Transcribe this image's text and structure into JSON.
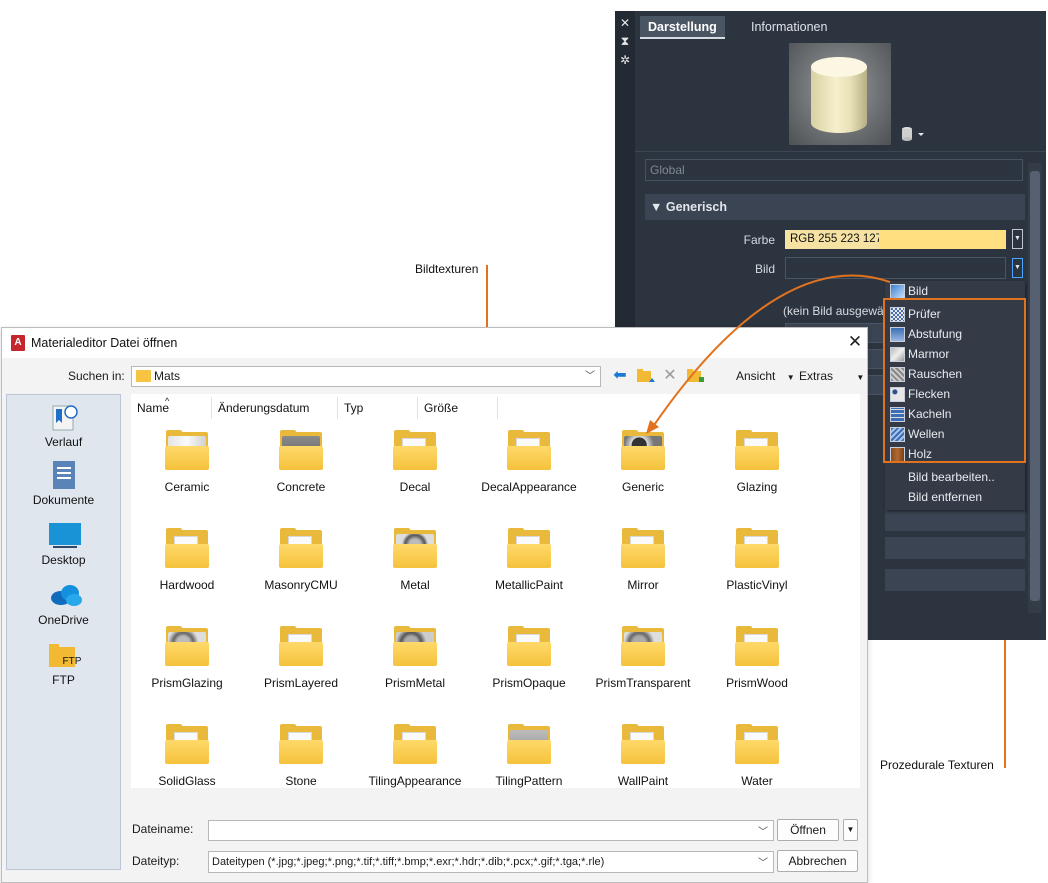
{
  "annotations": {
    "bildtexturen": "Bildtexturen",
    "prozedurale": "Prozedurale Texturen"
  },
  "panel": {
    "tool_close": "✕",
    "tool_pin": "⧗",
    "tool_gear": "✲",
    "tabs": [
      "Darstellung",
      "Informationen"
    ],
    "global": "Global",
    "section": "Generisch",
    "farbe_label": "Farbe",
    "farbe_value": "RGB 255 223 127",
    "bild_label": "Bild",
    "kein_bild": "(kein Bild ausgewä",
    "accent_color": "#e2731e",
    "swatch_color": "#ffdf7f"
  },
  "menu": {
    "bild": "Bild",
    "items": [
      "Prüfer",
      "Abstufung",
      "Marmor",
      "Rauschen",
      "Flecken",
      "Kacheln",
      "Wellen",
      "Holz"
    ],
    "edit": "Bild bearbeiten..",
    "remove": "Bild entfernen"
  },
  "dialog": {
    "title": "Materialeditor Datei öffnen",
    "app_icon": "A",
    "lookin_label": "Suchen in:",
    "lookin_value": "Mats",
    "view_label": "Ansicht",
    "extras_label": "Extras",
    "places": [
      "Verlauf",
      "Dokumente",
      "Desktop",
      "OneDrive",
      "FTP"
    ],
    "ftp_badge": "FTP",
    "columns": [
      "Name",
      "Änderungsdatum",
      "Typ",
      "Größe"
    ],
    "folders": [
      "Ceramic",
      "Concrete",
      "Decal",
      "DecalAppearance",
      "Generic",
      "Glazing",
      "Hardwood",
      "MasonryCMU",
      "Metal",
      "MetallicPaint",
      "Mirror",
      "PlasticVinyl",
      "PrismGlazing",
      "PrismLayered",
      "PrismMetal",
      "PrismOpaque",
      "PrismTransparent",
      "PrismWood",
      "SolidGlass",
      "Stone",
      "TilingAppearance",
      "TilingPattern",
      "WallPaint",
      "Water"
    ],
    "filename_label": "Dateiname:",
    "filename_value": "",
    "filetype_label": "Dateityp:",
    "filetype_value": "Dateitypen  (*.jpg;*.jpeg;*.png;*.tif;*.tiff;*.bmp;*.exr;*.hdr;*.dib;*.pcx;*.gif;*.tga;*.rle)",
    "open_button": "Öffnen",
    "cancel_button": "Abbrechen"
  }
}
